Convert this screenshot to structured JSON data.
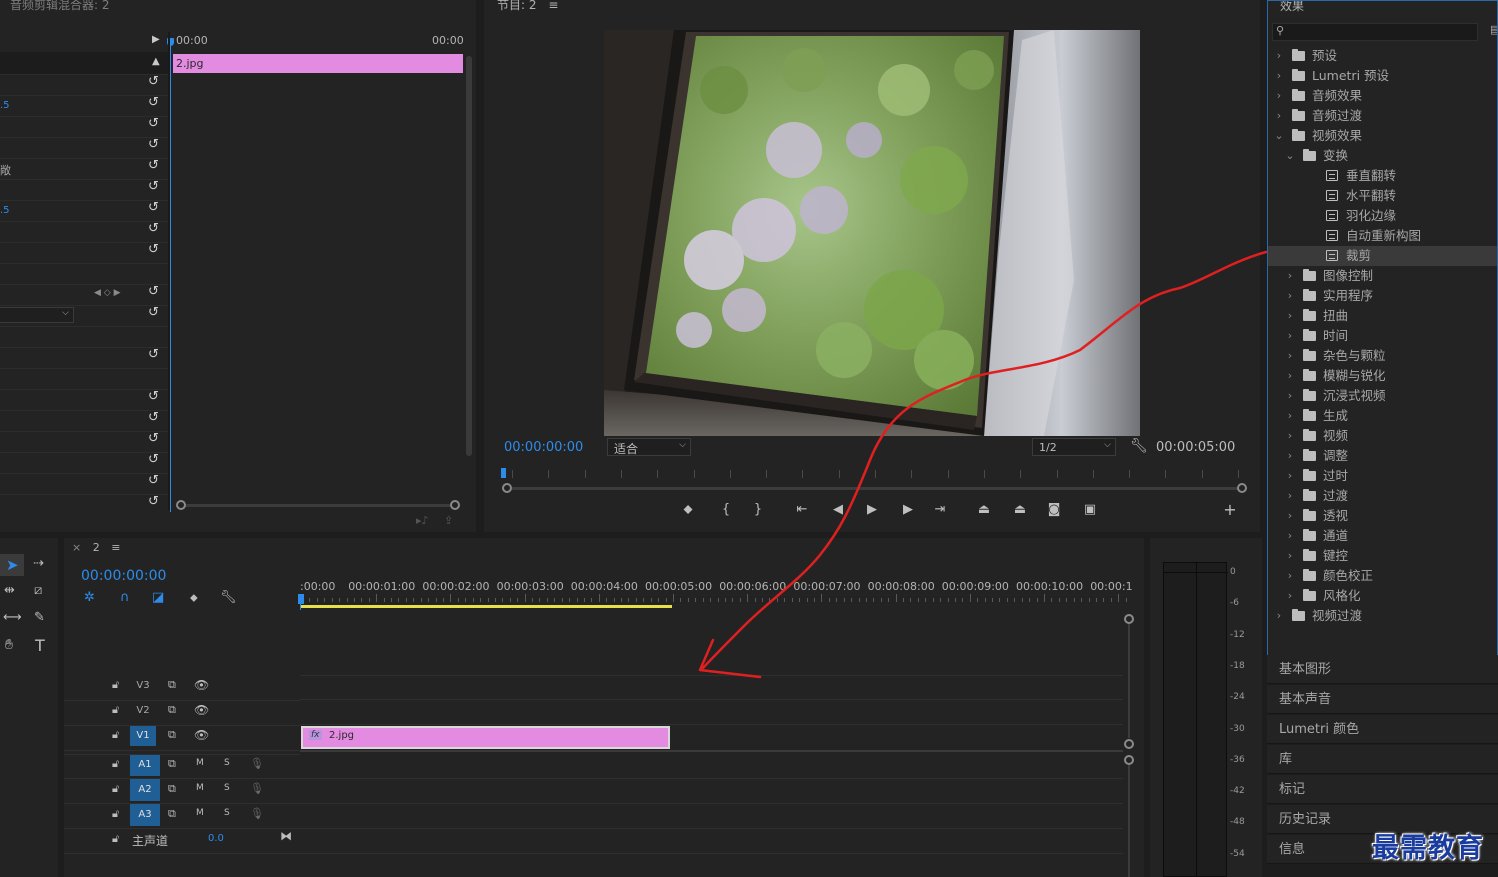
{
  "source_panel": {
    "title": "音频剪辑混合器: 2",
    "ruler_start": "00:00",
    "ruler_end": "00:00",
    "clip_name": "2.jpg",
    "value_1": ".5",
    "value_2": "敞",
    "value_3": ".5"
  },
  "program_monitor": {
    "title": "节目: 2",
    "timecode_current": "00:00:00:00",
    "fit_label": "适合",
    "resolution_label": "1/2",
    "timecode_duration": "00:00:05:00"
  },
  "effects_panel": {
    "title": "效果",
    "search_placeholder": "",
    "items": [
      {
        "label": "预设",
        "kind": "folder-preset",
        "level": 0,
        "expanded": false
      },
      {
        "label": "Lumetri 预设",
        "kind": "folder-preset",
        "level": 0,
        "expanded": false
      },
      {
        "label": "音频效果",
        "kind": "folder",
        "level": 0,
        "expanded": false
      },
      {
        "label": "音频过渡",
        "kind": "folder",
        "level": 0,
        "expanded": false
      },
      {
        "label": "视频效果",
        "kind": "folder",
        "level": 0,
        "expanded": true
      },
      {
        "label": "变换",
        "kind": "folder",
        "level": 1,
        "expanded": true
      },
      {
        "label": "垂直翻转",
        "kind": "effect",
        "level": 2
      },
      {
        "label": "水平翻转",
        "kind": "effect",
        "level": 2
      },
      {
        "label": "羽化边缘",
        "kind": "effect",
        "level": 2
      },
      {
        "label": "自动重新构图",
        "kind": "effect",
        "level": 2
      },
      {
        "label": "裁剪",
        "kind": "effect",
        "level": 2,
        "selected": true
      },
      {
        "label": "图像控制",
        "kind": "folder",
        "level": 1,
        "expanded": false
      },
      {
        "label": "实用程序",
        "kind": "folder",
        "level": 1,
        "expanded": false
      },
      {
        "label": "扭曲",
        "kind": "folder",
        "level": 1,
        "expanded": false
      },
      {
        "label": "时间",
        "kind": "folder",
        "level": 1,
        "expanded": false
      },
      {
        "label": "杂色与颗粒",
        "kind": "folder",
        "level": 1,
        "expanded": false
      },
      {
        "label": "模糊与锐化",
        "kind": "folder",
        "level": 1,
        "expanded": false
      },
      {
        "label": "沉浸式视频",
        "kind": "folder",
        "level": 1,
        "expanded": false
      },
      {
        "label": "生成",
        "kind": "folder",
        "level": 1,
        "expanded": false
      },
      {
        "label": "视频",
        "kind": "folder",
        "level": 1,
        "expanded": false
      },
      {
        "label": "调整",
        "kind": "folder",
        "level": 1,
        "expanded": false
      },
      {
        "label": "过时",
        "kind": "folder",
        "level": 1,
        "expanded": false
      },
      {
        "label": "过渡",
        "kind": "folder",
        "level": 1,
        "expanded": false
      },
      {
        "label": "透视",
        "kind": "folder",
        "level": 1,
        "expanded": false
      },
      {
        "label": "通道",
        "kind": "folder",
        "level": 1,
        "expanded": false
      },
      {
        "label": "键控",
        "kind": "folder",
        "level": 1,
        "expanded": false
      },
      {
        "label": "颜色校正",
        "kind": "folder",
        "level": 1,
        "expanded": false
      },
      {
        "label": "风格化",
        "kind": "folder",
        "level": 1,
        "expanded": false
      },
      {
        "label": "视频过渡",
        "kind": "folder",
        "level": 0,
        "expanded": false
      }
    ]
  },
  "side_tabs": [
    "基本图形",
    "基本声音",
    "Lumetri 颜色",
    "库",
    "标记",
    "历史记录",
    "信息"
  ],
  "timeline": {
    "tab_label": "2",
    "timecode": "00:00:00:00",
    "ruler_labels": [
      ":00:00",
      "00:00:01:00",
      "00:00:02:00",
      "00:00:03:00",
      "00:00:04:00",
      "00:00:05:00",
      "00:00:06:00",
      "00:00:07:00",
      "00:00:08:00",
      "00:00:09:00",
      "00:00:10:00",
      "00:00:1"
    ],
    "video_tracks": [
      "V3",
      "V2",
      "V1"
    ],
    "audio_tracks": [
      "A1",
      "A2",
      "A3"
    ],
    "audio_m": "M",
    "audio_s": "S",
    "master_label": "主声道",
    "master_value": "0.0",
    "clip_name": "2.jpg",
    "clip_fx": "fx"
  },
  "meter_labels": [
    "0",
    "-6",
    "-12",
    "-18",
    "-24",
    "-30",
    "-36",
    "-42",
    "-48",
    "-54"
  ],
  "watermark": "最需教育",
  "colors": {
    "accent_blue": "#2d8ceb",
    "clip_pink": "#e38be0",
    "annotation_red": "#e02020",
    "work_area_yellow": "#e8e04a"
  }
}
